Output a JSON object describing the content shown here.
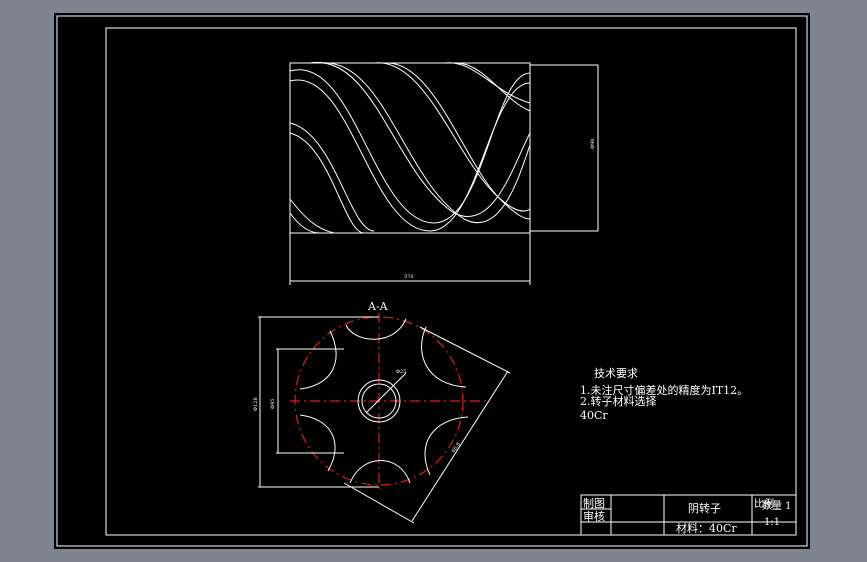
{
  "drawing": {
    "section_label": "A-A",
    "dim_length": "370",
    "dim_diameter": "Φ96",
    "dim_hole": "Φ25",
    "dim_a": "Φ128",
    "dim_b": "Φ85",
    "dim_c": "66.8"
  },
  "tech_requirements": {
    "heading": "技术要求",
    "item1": "1.未注尺寸偏差处的精度为IT12。",
    "item2": "2.转子材料选择",
    "item3": "40Cr"
  },
  "title_block": {
    "drawn_label": "制图",
    "checked_label": "审核",
    "part_name": "阴转子",
    "material": "材料：40Cr",
    "quantity_label": "数量 1",
    "scale_label": "1:1",
    "sheet_label": "比例"
  },
  "colors": {
    "background": "#7e8590",
    "sheet": "#000000",
    "lines": "#ffffff",
    "center_lines": "#e21b1b"
  }
}
